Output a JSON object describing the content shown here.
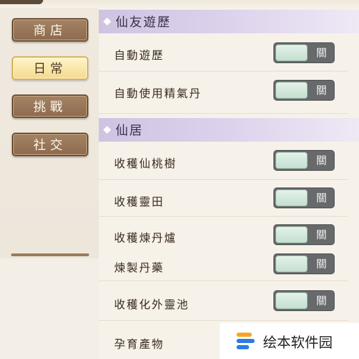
{
  "nav": {
    "items": [
      {
        "label": "商店",
        "active": false
      },
      {
        "label": "日常",
        "active": true
      },
      {
        "label": "挑戰",
        "active": false
      },
      {
        "label": "社交",
        "active": false
      }
    ]
  },
  "sections": {
    "xianyou": {
      "title": "仙友遊歷",
      "rows": [
        {
          "label": "自動遊歷",
          "toggle": "關"
        },
        {
          "label": "自動使用精氣丹",
          "toggle": "關"
        }
      ]
    },
    "xianju": {
      "title": "仙居",
      "rows": [
        {
          "label": "收穫仙桃樹",
          "toggle": "關"
        },
        {
          "label": "收穫靈田",
          "toggle": "關"
        },
        {
          "label": "收穫煉丹爐",
          "toggle": "關"
        },
        {
          "label": "煉製丹藥",
          "toggle": "關"
        },
        {
          "label": "收穫化外靈池",
          "toggle": "關"
        },
        {
          "label": "孕育產物",
          "toggle": null
        }
      ]
    }
  },
  "watermark": {
    "text": "绘本软件园"
  },
  "colors": {
    "section_header": "#d8cdea",
    "nav_button": "#957358",
    "nav_active": "#f7e3a2",
    "toggle_track": "#67696b",
    "toggle_knob": "#d6ebdf"
  }
}
